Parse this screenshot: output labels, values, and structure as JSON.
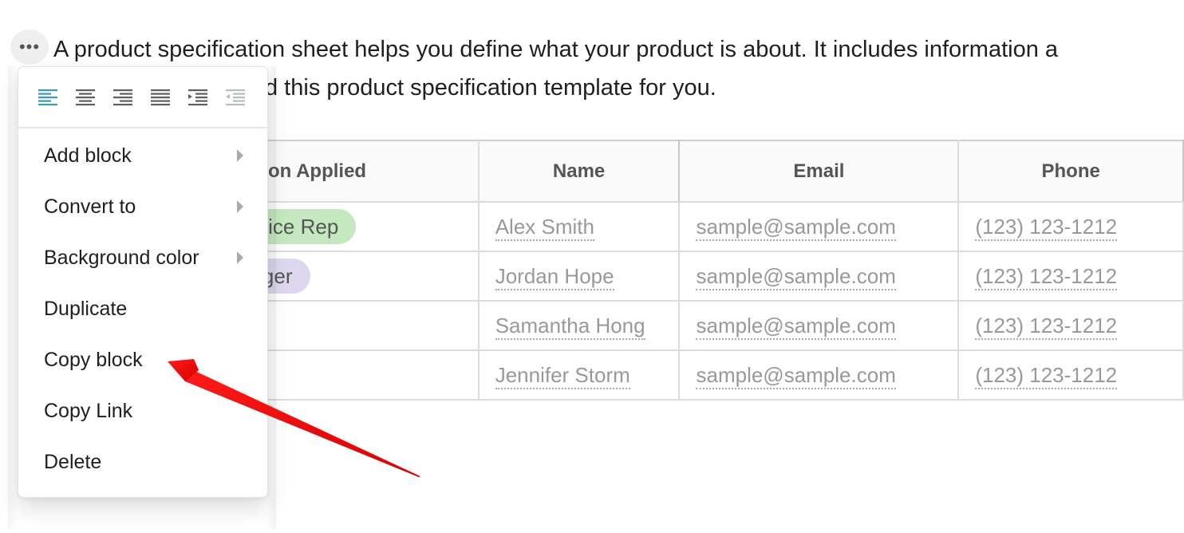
{
  "block": {
    "more_icon_glyph": "•••",
    "paragraph_line1": "A product specification sheet helps you define what your product is about. It includes information a",
    "paragraph_line2": "d this product specification template for you."
  },
  "table": {
    "headers": [
      "on Applied",
      "Name",
      "Email",
      "Phone"
    ],
    "rows": [
      {
        "role": "ervice Rep",
        "role_color": "#c5e8c0",
        "name": "Alex Smith",
        "email": "sample@sample.com",
        "phone": "(123) 123-1212"
      },
      {
        "role": "nager",
        "role_color": "#ddd8ef",
        "name": "Jordan Hope",
        "email": "sample@sample.com",
        "phone": "(123) 123-1212"
      },
      {
        "role": "",
        "role_color": "",
        "name": "Samantha Hong",
        "email": "sample@sample.com",
        "phone": "(123) 123-1212"
      },
      {
        "role": "",
        "role_color": "#f2e2b8",
        "name": "Jennifer Storm",
        "email": "sample@sample.com",
        "phone": "(123) 123-1212"
      }
    ]
  },
  "menu": {
    "alignment_buttons": [
      {
        "name": "align-left-icon",
        "active": true
      },
      {
        "name": "align-center-icon",
        "active": false
      },
      {
        "name": "align-right-icon",
        "active": false
      },
      {
        "name": "align-justify-icon",
        "active": false
      },
      {
        "name": "indent-icon",
        "active": false
      },
      {
        "name": "outdent-icon",
        "disabled": true
      }
    ],
    "items": [
      {
        "label": "Add block",
        "submenu": true
      },
      {
        "label": "Convert to",
        "submenu": true
      },
      {
        "label": "Background color",
        "submenu": true
      },
      {
        "label": "Duplicate",
        "submenu": false
      },
      {
        "label": "Copy block",
        "submenu": false
      },
      {
        "label": "Copy Link",
        "submenu": false
      },
      {
        "label": "Delete",
        "submenu": false
      }
    ]
  },
  "colors": {
    "accent_active": "#3a9bb3",
    "icon_gray": "#5f5f5f",
    "icon_disabled": "#b9bdbe",
    "annotation_arrow": "#e20000"
  }
}
